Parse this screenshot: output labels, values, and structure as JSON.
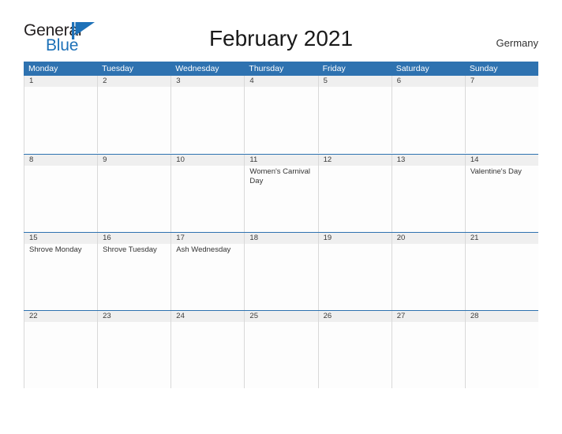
{
  "brand": {
    "word_one": "General",
    "word_two": "Blue",
    "flag_icon": "triangle-flag-icon",
    "word_one_color": "#231f20",
    "word_two_color": "#1d71b8",
    "flag_color": "#1d71b8"
  },
  "header": {
    "title": "February 2021",
    "locale": "Germany"
  },
  "theme": {
    "header_blue": "#2e72b0",
    "row_divider_blue": "#2e72b0",
    "day_band_gray": "#efefef",
    "cell_border_gray": "#d9d9d9",
    "page_background": "#ffffff"
  },
  "calendar": {
    "weekdays": [
      "Monday",
      "Tuesday",
      "Wednesday",
      "Thursday",
      "Friday",
      "Saturday",
      "Sunday"
    ],
    "weeks": [
      {
        "days": [
          {
            "number": "1",
            "events": []
          },
          {
            "number": "2",
            "events": []
          },
          {
            "number": "3",
            "events": []
          },
          {
            "number": "4",
            "events": []
          },
          {
            "number": "5",
            "events": []
          },
          {
            "number": "6",
            "events": []
          },
          {
            "number": "7",
            "events": []
          }
        ]
      },
      {
        "days": [
          {
            "number": "8",
            "events": []
          },
          {
            "number": "9",
            "events": []
          },
          {
            "number": "10",
            "events": []
          },
          {
            "number": "11",
            "events": [
              "Women's Carnival Day"
            ]
          },
          {
            "number": "12",
            "events": []
          },
          {
            "number": "13",
            "events": []
          },
          {
            "number": "14",
            "events": [
              "Valentine's Day"
            ]
          }
        ]
      },
      {
        "days": [
          {
            "number": "15",
            "events": [
              "Shrove Monday"
            ]
          },
          {
            "number": "16",
            "events": [
              "Shrove Tuesday"
            ]
          },
          {
            "number": "17",
            "events": [
              "Ash Wednesday"
            ]
          },
          {
            "number": "18",
            "events": []
          },
          {
            "number": "19",
            "events": []
          },
          {
            "number": "20",
            "events": []
          },
          {
            "number": "21",
            "events": []
          }
        ]
      },
      {
        "days": [
          {
            "number": "22",
            "events": []
          },
          {
            "number": "23",
            "events": []
          },
          {
            "number": "24",
            "events": []
          },
          {
            "number": "25",
            "events": []
          },
          {
            "number": "26",
            "events": []
          },
          {
            "number": "27",
            "events": []
          },
          {
            "number": "28",
            "events": []
          }
        ]
      }
    ]
  }
}
